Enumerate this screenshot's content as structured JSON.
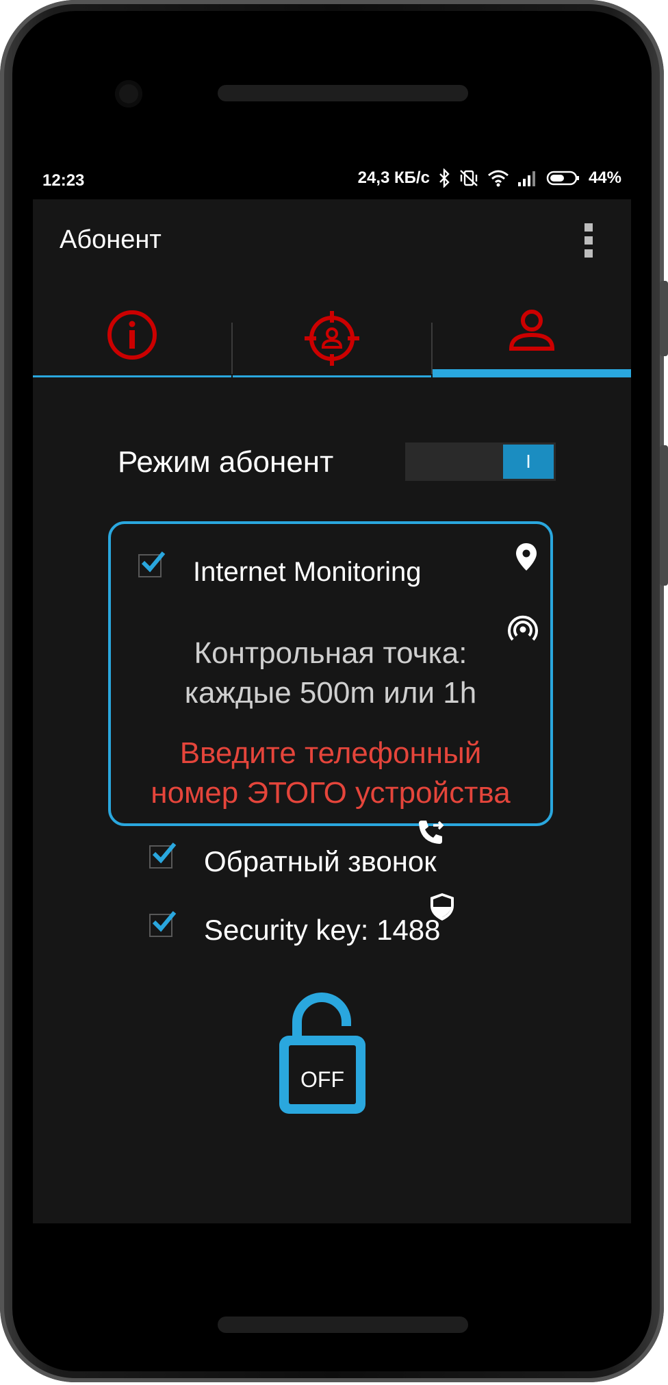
{
  "status_bar": {
    "time": "12:23",
    "speed": "24,3 КБ/с",
    "battery": "44%"
  },
  "app_bar": {
    "title": "Абонент",
    "menu_icon": "more-vert-icon"
  },
  "tabs": [
    {
      "icon": "info-icon",
      "active": false
    },
    {
      "icon": "target-person-icon",
      "active": false
    },
    {
      "icon": "person-icon",
      "active": true
    }
  ],
  "mode": {
    "label": "Режим абонент",
    "toggle_text": "I",
    "on": true
  },
  "card": {
    "checkbox_label": "Internet Monitoring",
    "checked": true,
    "checkpoint_line1": "Контрольная точка:",
    "checkpoint_line2": "каждые 500m или 1h",
    "warning_line1": "Введите телефонный",
    "warning_line2": "номер ЭТОГО устройства"
  },
  "callback": {
    "label": "Обратный звонок",
    "checked": true,
    "icon": "call-forward-icon"
  },
  "security": {
    "label": "Security key: 1488",
    "checked": true,
    "icon": "shield-icon"
  },
  "lock": {
    "label": "OFF",
    "icon": "lock-open-icon"
  },
  "colors": {
    "accent": "#2aa7de",
    "icon_red": "#cc0000",
    "warning": "#e5453b",
    "background": "#161616"
  }
}
